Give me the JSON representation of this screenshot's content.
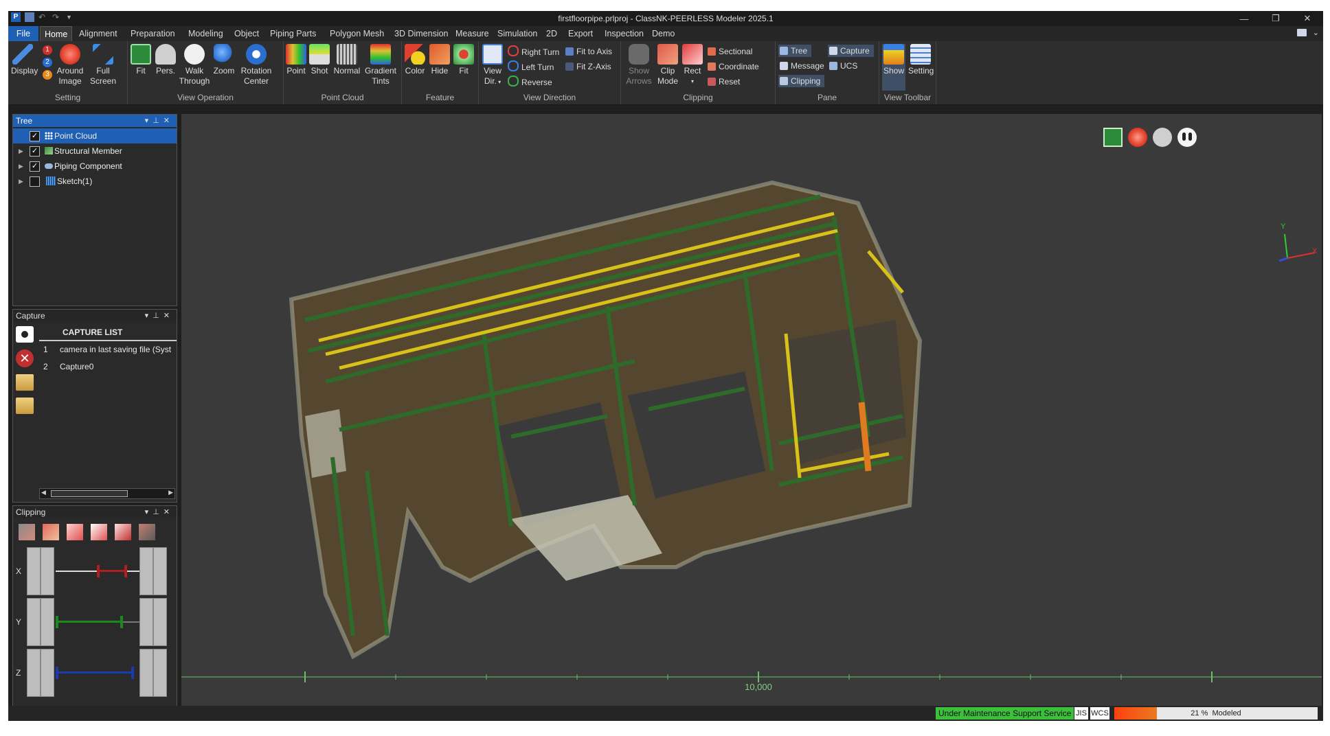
{
  "title": "firstfloorpipe.prlproj - ClassNK-PEERLESS Modeler 2025.1",
  "menu": {
    "file": "File",
    "tabs": [
      "Home",
      "Alignment",
      "Preparation",
      "Modeling",
      "Object",
      "Piping Parts",
      "Polygon Mesh",
      "3D Dimension",
      "Measure",
      "Simulation",
      "2D",
      "Export",
      "Inspection",
      "Demo"
    ],
    "active": "Home"
  },
  "ribbon": {
    "setting": {
      "label": "Setting",
      "display": "Display",
      "around_image": [
        "Around",
        "Image"
      ],
      "full_screen": [
        "Full",
        "Screen"
      ],
      "badges": [
        "1",
        "2",
        "3"
      ]
    },
    "view_operation": {
      "label": "View Operation",
      "fit": "Fit",
      "pers": "Pers.",
      "walk": [
        "Walk",
        "Through"
      ],
      "zoom": "Zoom",
      "rotation": [
        "Rotation",
        "Center"
      ]
    },
    "point_cloud": {
      "label": "Point Cloud",
      "point": "Point",
      "shot": "Shot",
      "normal": "Normal",
      "gradient": [
        "Gradient",
        "Tints"
      ]
    },
    "feature": {
      "label": "Feature",
      "color": "Color",
      "hide": "Hide",
      "fit": "Fit"
    },
    "view_direction": {
      "label": "View Direction",
      "view_dir": [
        "View",
        "Dir."
      ],
      "right_turn": "Right Turn",
      "left_turn": "Left Turn",
      "reverse": "Reverse",
      "fit_axis": "Fit to Axis",
      "fit_z": "Fit Z-Axis"
    },
    "clipping": {
      "label": "Clipping",
      "show_arrows": [
        "Show",
        "Arrows"
      ],
      "clip_mode": [
        "Clip",
        "Mode"
      ],
      "rect": "Rect",
      "sectional": "Sectional",
      "coordinate": "Coordinate",
      "reset": "Reset"
    },
    "pane": {
      "label": "Pane",
      "tree": "Tree",
      "message": "Message",
      "clipping": "Clipping",
      "capture": "Capture",
      "ucs": "UCS"
    },
    "view_toolbar": {
      "label": "View Toolbar",
      "show": "Show",
      "setting": "Setting"
    }
  },
  "tree_panel": {
    "title": "Tree",
    "items": [
      {
        "label": "Point Cloud",
        "checked": "✓"
      },
      {
        "label": "Structural Member",
        "checked": "✓"
      },
      {
        "label": "Piping Component",
        "checked": "✓"
      },
      {
        "label": "Sketch(1)",
        "checked": ""
      }
    ]
  },
  "capture_panel": {
    "title": "Capture",
    "header": "CAPTURE LIST",
    "rows": [
      {
        "num": "1",
        "name": "camera in last saving file (Syst"
      },
      {
        "num": "2",
        "name": "Capture0"
      }
    ]
  },
  "clipping_panel": {
    "title": "Clipping",
    "axes": [
      "X",
      "Y",
      "Z"
    ]
  },
  "viewport": {
    "scale_label": "10,000",
    "axis_labels": {
      "y": "Y",
      "x": "X"
    }
  },
  "status": {
    "support": "Under Maintenance Support Service",
    "jis": "JIS",
    "wcs": "WCS",
    "progress_text": "21 %  Modeled",
    "progress_fraction": 0.21
  },
  "colors": {
    "accent": "#1f5fb4",
    "support_bg": "#3cc03c",
    "progress_fill": "#e23a10",
    "pipe_yellow": "#d8c21a",
    "steel_green": "#2e6b2a"
  }
}
